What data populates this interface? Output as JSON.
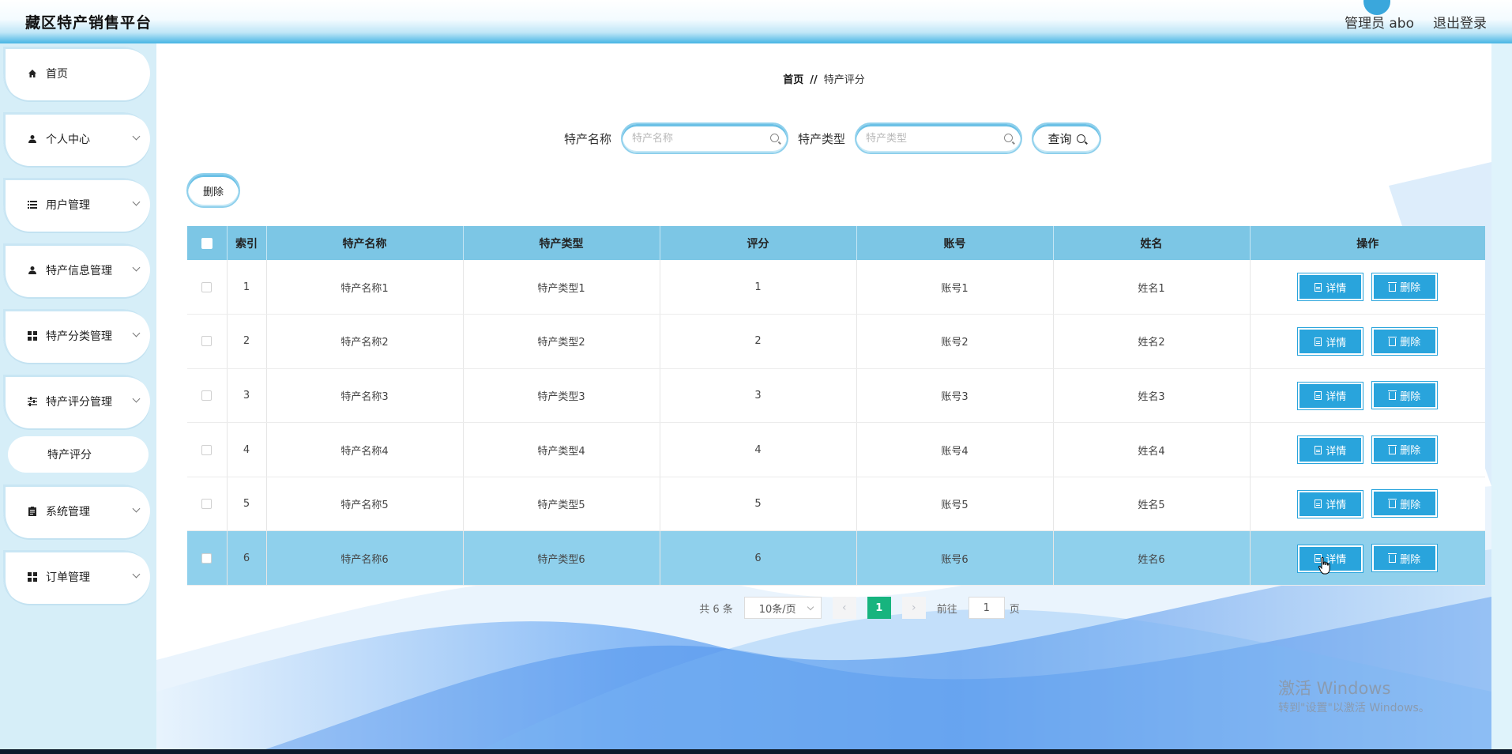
{
  "app": {
    "title": "藏区特产销售平台"
  },
  "header": {
    "user": "管理员 abo",
    "logout": "退出登录"
  },
  "sidebar": {
    "items": [
      {
        "label": "首页",
        "icon": "home-icon"
      },
      {
        "label": "个人中心",
        "icon": "user-icon"
      },
      {
        "label": "用户管理",
        "icon": "list-icon"
      },
      {
        "label": "特产信息管理",
        "icon": "user-icon"
      },
      {
        "label": "特产分类管理",
        "icon": "grid-icon"
      },
      {
        "label": "特产评分管理",
        "icon": "sliders-icon"
      },
      {
        "label": "系统管理",
        "icon": "clipboard-icon"
      },
      {
        "label": "订单管理",
        "icon": "grid-icon"
      }
    ],
    "sub_item": "特产评分"
  },
  "breadcrumb": {
    "home": "首页",
    "sep": "//",
    "current": "特产评分"
  },
  "search": {
    "name_label": "特产名称",
    "name_placeholder": "特产名称",
    "type_label": "特产类型",
    "type_placeholder": "特产类型",
    "query": "查询"
  },
  "toolbar": {
    "delete": "删除"
  },
  "table": {
    "headers": [
      "索引",
      "特产名称",
      "特产类型",
      "评分",
      "账号",
      "姓名",
      "操作"
    ],
    "rows": [
      {
        "index": "1",
        "name": "特产名称1",
        "type": "特产类型1",
        "score": "1",
        "account": "账号1",
        "realname": "姓名1"
      },
      {
        "index": "2",
        "name": "特产名称2",
        "type": "特产类型2",
        "score": "2",
        "account": "账号2",
        "realname": "姓名2"
      },
      {
        "index": "3",
        "name": "特产名称3",
        "type": "特产类型3",
        "score": "3",
        "account": "账号3",
        "realname": "姓名3"
      },
      {
        "index": "4",
        "name": "特产名称4",
        "type": "特产类型4",
        "score": "4",
        "account": "账号4",
        "realname": "姓名4"
      },
      {
        "index": "5",
        "name": "特产名称5",
        "type": "特产类型5",
        "score": "5",
        "account": "账号5",
        "realname": "姓名5"
      },
      {
        "index": "6",
        "name": "特产名称6",
        "type": "特产类型6",
        "score": "6",
        "account": "账号6",
        "realname": "姓名6"
      }
    ],
    "detail_label": "详情",
    "delete_label": "删除"
  },
  "pagination": {
    "total": "共 6 条",
    "page_size": "10条/页",
    "current": "1",
    "goto_label": "前往",
    "goto_value": "1",
    "page_suffix": "页"
  },
  "watermark": {
    "title": "激活 Windows",
    "subtitle": "转到\"设置\"以激活 Windows。"
  },
  "colors": {
    "accent": "#29a4dc",
    "table_header": "#7cc6e5",
    "highlight_row": "#8fd0ec",
    "page_active": "#17b47e"
  }
}
